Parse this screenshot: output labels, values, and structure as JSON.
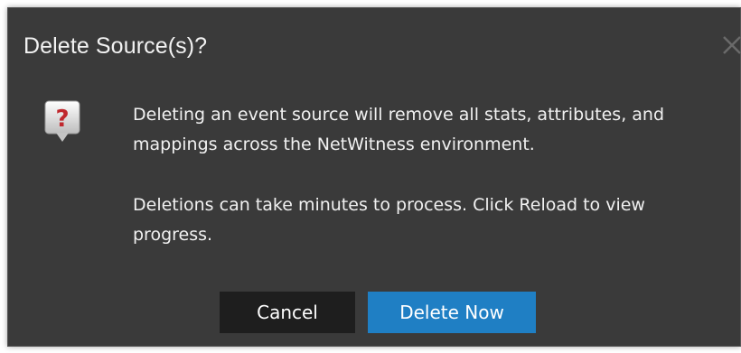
{
  "dialog": {
    "title": "Delete Source(s)?",
    "close_icon": "close-icon",
    "help_icon": "question-speech-bubble-icon",
    "message_1": "Deleting an event source will remove all stats, attributes, and mappings across the NetWitness environment.",
    "message_2": "Deletions can take minutes to process. Click Reload to view progress.",
    "cancel_label": "Cancel",
    "delete_label": "Delete Now"
  },
  "colors": {
    "dialog_bg": "#3a3a3a",
    "text": "#f1f1f1",
    "cancel_bg": "#1e1e1e",
    "primary_bg": "#1f7fc4",
    "icon_red": "#c0272d"
  }
}
